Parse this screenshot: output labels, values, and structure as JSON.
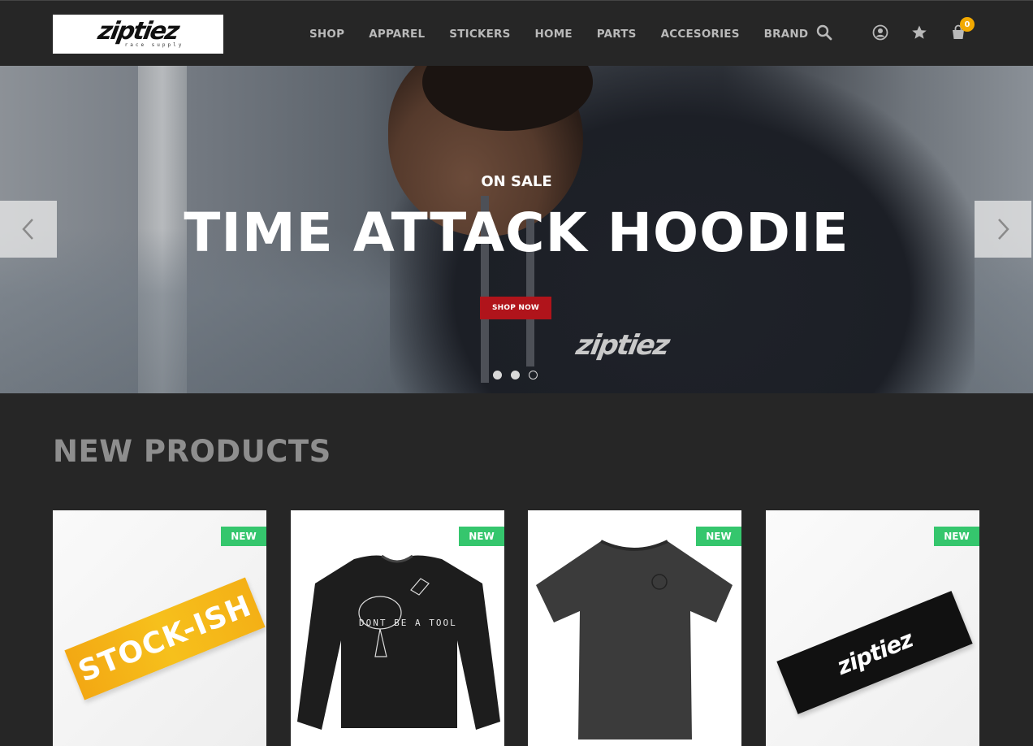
{
  "brand": {
    "logo_text": "ziptiez",
    "logo_sub": "race supply"
  },
  "nav": {
    "items": [
      {
        "label": "SHOP"
      },
      {
        "label": "APPAREL"
      },
      {
        "label": "STICKERS"
      },
      {
        "label": "HOME"
      },
      {
        "label": "PARTS"
      },
      {
        "label": "ACCESORIES"
      },
      {
        "label": "BRAND"
      }
    ]
  },
  "header_icons": {
    "search": "search-icon",
    "account": "user-icon",
    "wishlist": "star-icon",
    "cart": "cart-icon",
    "cart_count": "0"
  },
  "hero": {
    "tag": "ON SALE",
    "title": "TIME ATTACK HOODIE",
    "cta": "SHOP NOW",
    "hoodie_print": "ziptiez",
    "slides": 3,
    "active_slide": 1
  },
  "products_section": {
    "title": "NEW PRODUCTS",
    "products": [
      {
        "badge": "NEW",
        "art_text": "STOCK-ISH"
      },
      {
        "badge": "NEW",
        "art_text": "DONT BE A TOOL"
      },
      {
        "badge": "NEW"
      },
      {
        "badge": "NEW",
        "art_text": "ziptiez"
      }
    ]
  },
  "colors": {
    "background": "#262626",
    "nav_text": "#b9b9b9",
    "cta": "#b0141b",
    "badge": "#35c66d",
    "cart_badge": "#f2a900"
  }
}
